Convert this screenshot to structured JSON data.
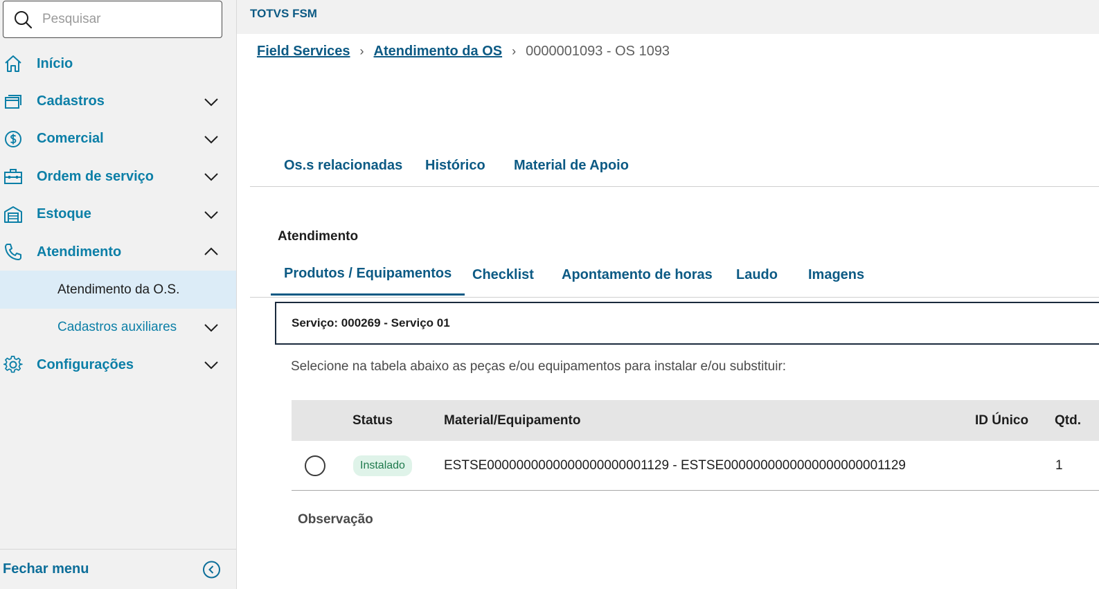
{
  "search": {
    "placeholder": "Pesquisar"
  },
  "sidebar": {
    "items": [
      {
        "label": "Início",
        "icon": "home-icon"
      },
      {
        "label": "Cadastros",
        "icon": "cards-icon"
      },
      {
        "label": "Comercial",
        "icon": "dollar-icon"
      },
      {
        "label": "Ordem de serviço",
        "icon": "briefcase-icon"
      },
      {
        "label": "Estoque",
        "icon": "warehouse-icon"
      },
      {
        "label": "Atendimento",
        "icon": "phone-icon"
      }
    ],
    "subitems": [
      {
        "label": "Atendimento da O.S."
      },
      {
        "label": "Cadastros auxiliares"
      }
    ],
    "config": {
      "label": "Configurações",
      "icon": "gear-icon"
    },
    "close_menu": "Fechar menu"
  },
  "header": {
    "app_title": "TOTVS FSM"
  },
  "breadcrumb": {
    "items": [
      "Field Services",
      "Atendimento da OS"
    ],
    "current": "0000001093 - OS 1093"
  },
  "tabs_top": [
    "Os.s relacionadas",
    "Histórico",
    "Material de Apoio"
  ],
  "section": {
    "title": "Atendimento"
  },
  "tabs_sub": [
    "Produtos / Equipamentos",
    "Checklist",
    "Apontamento de horas",
    "Laudo",
    "Imagens"
  ],
  "service": {
    "label": "Serviço: 000269 - Serviço 01"
  },
  "instruction": "Selecione na tabela abaixo as peças e/ou equipamentos para instalar e/ou substituir:",
  "table": {
    "headers": {
      "status": "Status",
      "material": "Material/Equipamento",
      "id": "ID Único",
      "qtd": "Qtd."
    },
    "rows": [
      {
        "status": "Instalado",
        "material": "ESTSE0000000000000000000001129 - ESTSE0000000000000000000001129",
        "id": "",
        "qtd": "1"
      }
    ]
  },
  "observation": {
    "label": "Observação"
  },
  "colors": {
    "accent": "#0c7fa7",
    "dark_accent": "#0c5a84",
    "active_bg": "#dcecf7",
    "badge_bg": "#dff3e9",
    "badge_text": "#1f7a4d"
  }
}
